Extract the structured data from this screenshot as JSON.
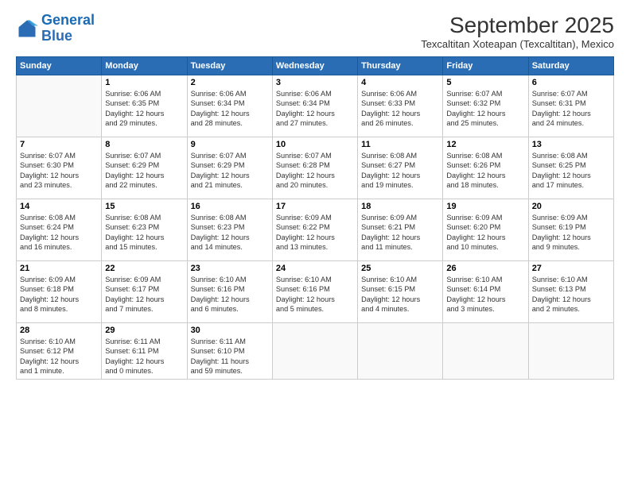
{
  "header": {
    "logo_general": "General",
    "logo_blue": "Blue",
    "month_title": "September 2025",
    "location": "Texcaltitan Xoteapan (Texcaltitan), Mexico"
  },
  "weekdays": [
    "Sunday",
    "Monday",
    "Tuesday",
    "Wednesday",
    "Thursday",
    "Friday",
    "Saturday"
  ],
  "weeks": [
    [
      {
        "day": "",
        "info": ""
      },
      {
        "day": "1",
        "info": "Sunrise: 6:06 AM\nSunset: 6:35 PM\nDaylight: 12 hours\nand 29 minutes."
      },
      {
        "day": "2",
        "info": "Sunrise: 6:06 AM\nSunset: 6:34 PM\nDaylight: 12 hours\nand 28 minutes."
      },
      {
        "day": "3",
        "info": "Sunrise: 6:06 AM\nSunset: 6:34 PM\nDaylight: 12 hours\nand 27 minutes."
      },
      {
        "day": "4",
        "info": "Sunrise: 6:06 AM\nSunset: 6:33 PM\nDaylight: 12 hours\nand 26 minutes."
      },
      {
        "day": "5",
        "info": "Sunrise: 6:07 AM\nSunset: 6:32 PM\nDaylight: 12 hours\nand 25 minutes."
      },
      {
        "day": "6",
        "info": "Sunrise: 6:07 AM\nSunset: 6:31 PM\nDaylight: 12 hours\nand 24 minutes."
      }
    ],
    [
      {
        "day": "7",
        "info": "Sunrise: 6:07 AM\nSunset: 6:30 PM\nDaylight: 12 hours\nand 23 minutes."
      },
      {
        "day": "8",
        "info": "Sunrise: 6:07 AM\nSunset: 6:29 PM\nDaylight: 12 hours\nand 22 minutes."
      },
      {
        "day": "9",
        "info": "Sunrise: 6:07 AM\nSunset: 6:29 PM\nDaylight: 12 hours\nand 21 minutes."
      },
      {
        "day": "10",
        "info": "Sunrise: 6:07 AM\nSunset: 6:28 PM\nDaylight: 12 hours\nand 20 minutes."
      },
      {
        "day": "11",
        "info": "Sunrise: 6:08 AM\nSunset: 6:27 PM\nDaylight: 12 hours\nand 19 minutes."
      },
      {
        "day": "12",
        "info": "Sunrise: 6:08 AM\nSunset: 6:26 PM\nDaylight: 12 hours\nand 18 minutes."
      },
      {
        "day": "13",
        "info": "Sunrise: 6:08 AM\nSunset: 6:25 PM\nDaylight: 12 hours\nand 17 minutes."
      }
    ],
    [
      {
        "day": "14",
        "info": "Sunrise: 6:08 AM\nSunset: 6:24 PM\nDaylight: 12 hours\nand 16 minutes."
      },
      {
        "day": "15",
        "info": "Sunrise: 6:08 AM\nSunset: 6:23 PM\nDaylight: 12 hours\nand 15 minutes."
      },
      {
        "day": "16",
        "info": "Sunrise: 6:08 AM\nSunset: 6:23 PM\nDaylight: 12 hours\nand 14 minutes."
      },
      {
        "day": "17",
        "info": "Sunrise: 6:09 AM\nSunset: 6:22 PM\nDaylight: 12 hours\nand 13 minutes."
      },
      {
        "day": "18",
        "info": "Sunrise: 6:09 AM\nSunset: 6:21 PM\nDaylight: 12 hours\nand 11 minutes."
      },
      {
        "day": "19",
        "info": "Sunrise: 6:09 AM\nSunset: 6:20 PM\nDaylight: 12 hours\nand 10 minutes."
      },
      {
        "day": "20",
        "info": "Sunrise: 6:09 AM\nSunset: 6:19 PM\nDaylight: 12 hours\nand 9 minutes."
      }
    ],
    [
      {
        "day": "21",
        "info": "Sunrise: 6:09 AM\nSunset: 6:18 PM\nDaylight: 12 hours\nand 8 minutes."
      },
      {
        "day": "22",
        "info": "Sunrise: 6:09 AM\nSunset: 6:17 PM\nDaylight: 12 hours\nand 7 minutes."
      },
      {
        "day": "23",
        "info": "Sunrise: 6:10 AM\nSunset: 6:16 PM\nDaylight: 12 hours\nand 6 minutes."
      },
      {
        "day": "24",
        "info": "Sunrise: 6:10 AM\nSunset: 6:16 PM\nDaylight: 12 hours\nand 5 minutes."
      },
      {
        "day": "25",
        "info": "Sunrise: 6:10 AM\nSunset: 6:15 PM\nDaylight: 12 hours\nand 4 minutes."
      },
      {
        "day": "26",
        "info": "Sunrise: 6:10 AM\nSunset: 6:14 PM\nDaylight: 12 hours\nand 3 minutes."
      },
      {
        "day": "27",
        "info": "Sunrise: 6:10 AM\nSunset: 6:13 PM\nDaylight: 12 hours\nand 2 minutes."
      }
    ],
    [
      {
        "day": "28",
        "info": "Sunrise: 6:10 AM\nSunset: 6:12 PM\nDaylight: 12 hours\nand 1 minute."
      },
      {
        "day": "29",
        "info": "Sunrise: 6:11 AM\nSunset: 6:11 PM\nDaylight: 12 hours\nand 0 minutes."
      },
      {
        "day": "30",
        "info": "Sunrise: 6:11 AM\nSunset: 6:10 PM\nDaylight: 11 hours\nand 59 minutes."
      },
      {
        "day": "",
        "info": ""
      },
      {
        "day": "",
        "info": ""
      },
      {
        "day": "",
        "info": ""
      },
      {
        "day": "",
        "info": ""
      }
    ]
  ]
}
